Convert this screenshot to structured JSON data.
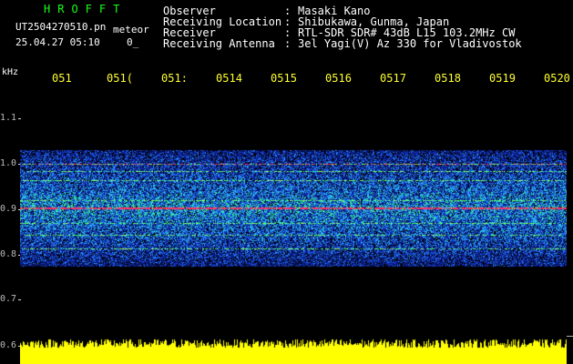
{
  "header": {
    "logo": "HROFFT",
    "filename": "UT2504270510.pn",
    "tag": "meteor",
    "timestamp": "25.04.27 05:10",
    "count": "0_"
  },
  "info": [
    {
      "label": "Observer",
      "value": "Masaki Kano"
    },
    {
      "label": "Receiving Location",
      "value": "Shibukawa, Gunma, Japan"
    },
    {
      "label": "Receiver",
      "value": "RTL-SDR SDR# 43dB L15 103.2MHz CW"
    },
    {
      "label": "Receiving Antenna",
      "value": "3el Yagi(V) Az 330 for Vladivostok"
    }
  ],
  "info_separator": ":",
  "axis": {
    "y_unit": "kHz",
    "y_ticks": [
      "1.1",
      "1.0",
      "0.9",
      "0.8",
      "0.7",
      "0.6"
    ],
    "x_ticks": [
      "051",
      "051",
      "051",
      "051",
      "051",
      "051",
      "051",
      "051",
      "051",
      "0520"
    ],
    "x_ticks_partial_glyph": [
      "",
      "(",
      ":",
      "4",
      "5",
      "6",
      "7",
      "8",
      "9",
      ""
    ]
  },
  "colors": {
    "background": "#000000",
    "logo": "#18ff18",
    "x_tick_text": "#ffff30",
    "noise_low": "#0a1a8a",
    "noise_mid": "#2a8cff",
    "noise_high": "#3dff70",
    "signal_line": "#ff3060",
    "bottom_strip": "#ffff00"
  },
  "chart_data": {
    "type": "heatmap",
    "ylabel": "kHz",
    "ylim": [
      0.6,
      1.15
    ],
    "x": [
      "051",
      "051",
      "051",
      "051",
      "051",
      "051",
      "051",
      "051",
      "051",
      "0520"
    ],
    "noise_band_khz": [
      0.775,
      1.03
    ],
    "signal_lines_khz": [
      1.0,
      0.985,
      0.965,
      0.92,
      0.905,
      0.87,
      0.845,
      0.815
    ],
    "strong_line_khz": 0.905,
    "grid": false
  }
}
